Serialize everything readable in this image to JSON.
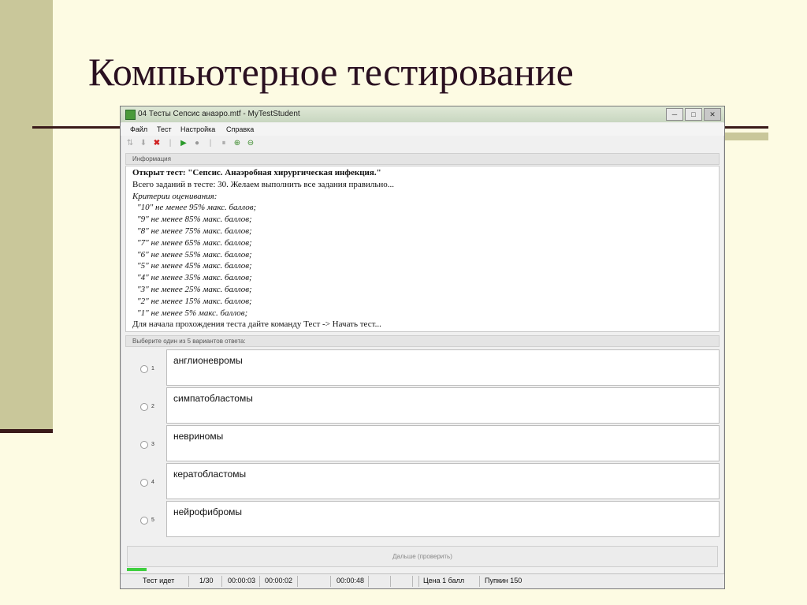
{
  "slide": {
    "title": "Компьютерное тестирование"
  },
  "window": {
    "title": "04 Тесты Сепсис анаэро.mtf - MyTestStudent",
    "buttons": {
      "minimize": "─",
      "maximize": "□",
      "close": "✕"
    }
  },
  "menu": [
    "Файл",
    "Тест",
    "Настройка",
    "Справка"
  ],
  "toolbar": {
    "icons": [
      "arrow-up-icon",
      "arrow-down-icon",
      "stop-x-icon",
      "play-icon",
      "record-icon",
      "pause-icon",
      "zoom-in-icon",
      "zoom-out-icon"
    ],
    "colors": {
      "play": "#2a9a2a",
      "stop": "#d02020",
      "zoom": "#3a8a2a"
    }
  },
  "info": {
    "header": "Информация",
    "lines": [
      "Открыт тест: \"Сепсис. Анаэробная хирургическая инфекция.\"",
      "Всего заданий в тесте: 30. Желаем выполнить все задания правильно...",
      "Критерии оценивания:",
      "\"10\" не менее 95% макс. баллов;",
      "\"9\" не менее 85% макс. баллов;",
      "\"8\" не менее 75% макс. баллов;",
      "\"7\" не менее 65% макс. баллов;",
      "\"6\" не менее 55% макс. баллов;",
      "\"5\" не менее 45% макс. баллов;",
      "\"4\" не менее 35% макс. баллов;",
      "\"3\" не менее 25% макс. баллов;",
      "\"2\" не менее 15% макс. баллов;",
      "\"1\" не менее 5% макс. баллов;",
      "Для начала прохождения теста дайте команду Тест -> Начать тест..."
    ]
  },
  "question": {
    "header": "Выберите один из 5 вариантов ответа:",
    "answers": [
      {
        "num": "1",
        "text": "англионевромы"
      },
      {
        "num": "2",
        "text": "симпатобластомы"
      },
      {
        "num": "3",
        "text": "невриномы"
      },
      {
        "num": "4",
        "text": "кератобластомы"
      },
      {
        "num": "5",
        "text": "нейрофибромы"
      }
    ]
  },
  "next_button": "Дальше (проверить)",
  "status": {
    "state": "Тест идет",
    "progress": "1/30",
    "time1": "00:00:03",
    "time2": "00:00:02",
    "time3": "00:00:48",
    "price": "Цена 1 балл",
    "user": "Пупкин 150"
  }
}
